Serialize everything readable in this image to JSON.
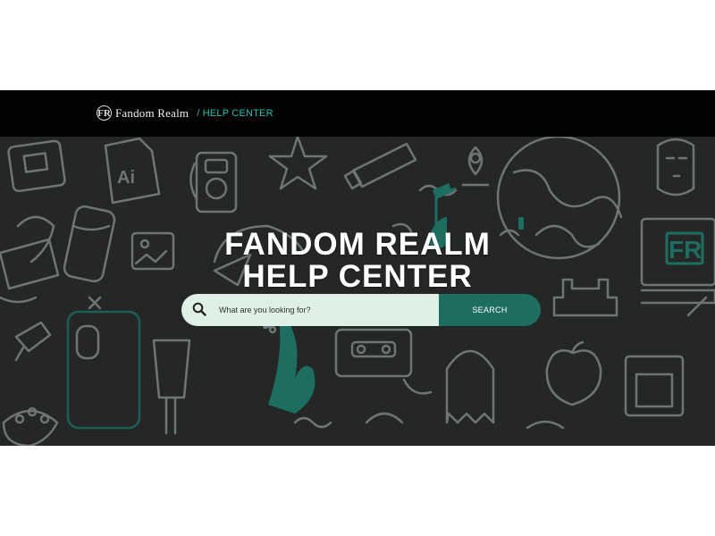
{
  "header": {
    "logo_letter": "FR",
    "brand_name": "Fandom Realm",
    "breadcrumb": "/ HELP CENTER"
  },
  "hero": {
    "title_line1": "FANDOM REALM",
    "title_line2": "HELP CENTER",
    "doodle_text_ai": "Ai",
    "doodle_text_fr": "FR"
  },
  "search": {
    "placeholder": "What are you looking for?",
    "button_label": "SEARCH"
  },
  "colors": {
    "topbar": "#020202",
    "hero_bg": "#242726",
    "accent_teal": "#1d6e61",
    "breadcrumb_teal": "#22c3ad",
    "search_field": "#dff0e6"
  }
}
